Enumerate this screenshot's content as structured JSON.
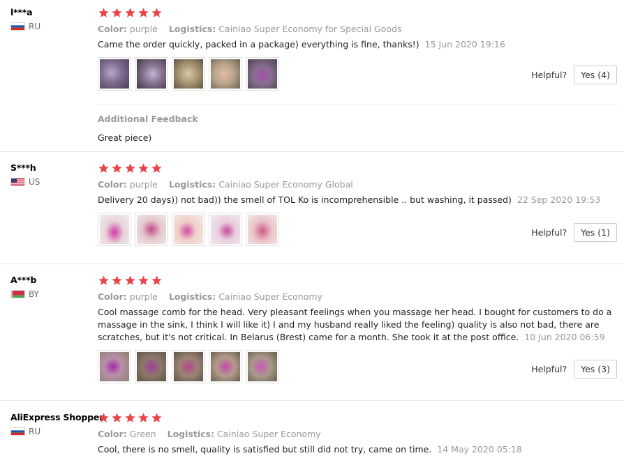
{
  "reviews": [
    {
      "user": "l***a",
      "country": "RU",
      "stars": 5,
      "color_label": "Color:",
      "color_value": "purple",
      "logistics_label": "Logistics:",
      "logistics_value": "Cainiao Super Economy for Special Goods",
      "text": "Came the order quickly, packed in a package) everything is fine, thanks!)",
      "date": "15 Jun 2020 19:16",
      "helpful_label": "Helpful?",
      "yes_label": "Yes (4)",
      "photo_count": 5,
      "additional_feedback_title": "Additional Feedback",
      "additional_feedback_text": "Great piece)"
    },
    {
      "user": "S***h",
      "country": "US",
      "stars": 5,
      "color_label": "Color:",
      "color_value": "purple",
      "logistics_label": "Logistics:",
      "logistics_value": "Cainiao Super Economy Global",
      "text": "Delivery 20 days)) not bad)) the smell of TOL Ko is incomprehensible .. but washing, it passed)",
      "date": "22 Sep 2020 19:53",
      "helpful_label": "Helpful?",
      "yes_label": "Yes (1)",
      "photo_count": 5
    },
    {
      "user": "A***b",
      "country": "BY",
      "stars": 5,
      "color_label": "Color:",
      "color_value": "purple",
      "logistics_label": "Logistics:",
      "logistics_value": "Cainiao Super Economy",
      "text": "Cool massage comb for the head. Very pleasant feelings when you massage her head. I bought for customers to do a massage in the sink, I think I will like it) I and my husband really liked the feeling) quality is also not bad, there are scratches, but it's not critical. In Belarus (Brest) came for a month. She took it at the post office.",
      "date": "10 Jun 2020 06:59",
      "helpful_label": "Helpful?",
      "yes_label": "Yes (3)",
      "photo_count": 5
    },
    {
      "user": "AliExpress Shopper",
      "country": "RU",
      "stars": 5,
      "color_label": "Color:",
      "color_value": "Green",
      "logistics_label": "Logistics:",
      "logistics_value": "Cainiao Super Economy",
      "text": "Cool, there is no smell, quality is satisfied but still did not try, came on time.",
      "date": "14 May 2020 05:18"
    }
  ],
  "colors": {
    "star": "#e6454a",
    "muted_text": "#999999",
    "border": "#e8e8e8"
  },
  "icons": {
    "star": "star-icon",
    "flag_ru": "flag-ru-icon",
    "flag_us": "flag-us-icon",
    "flag_by": "flag-by-icon"
  }
}
